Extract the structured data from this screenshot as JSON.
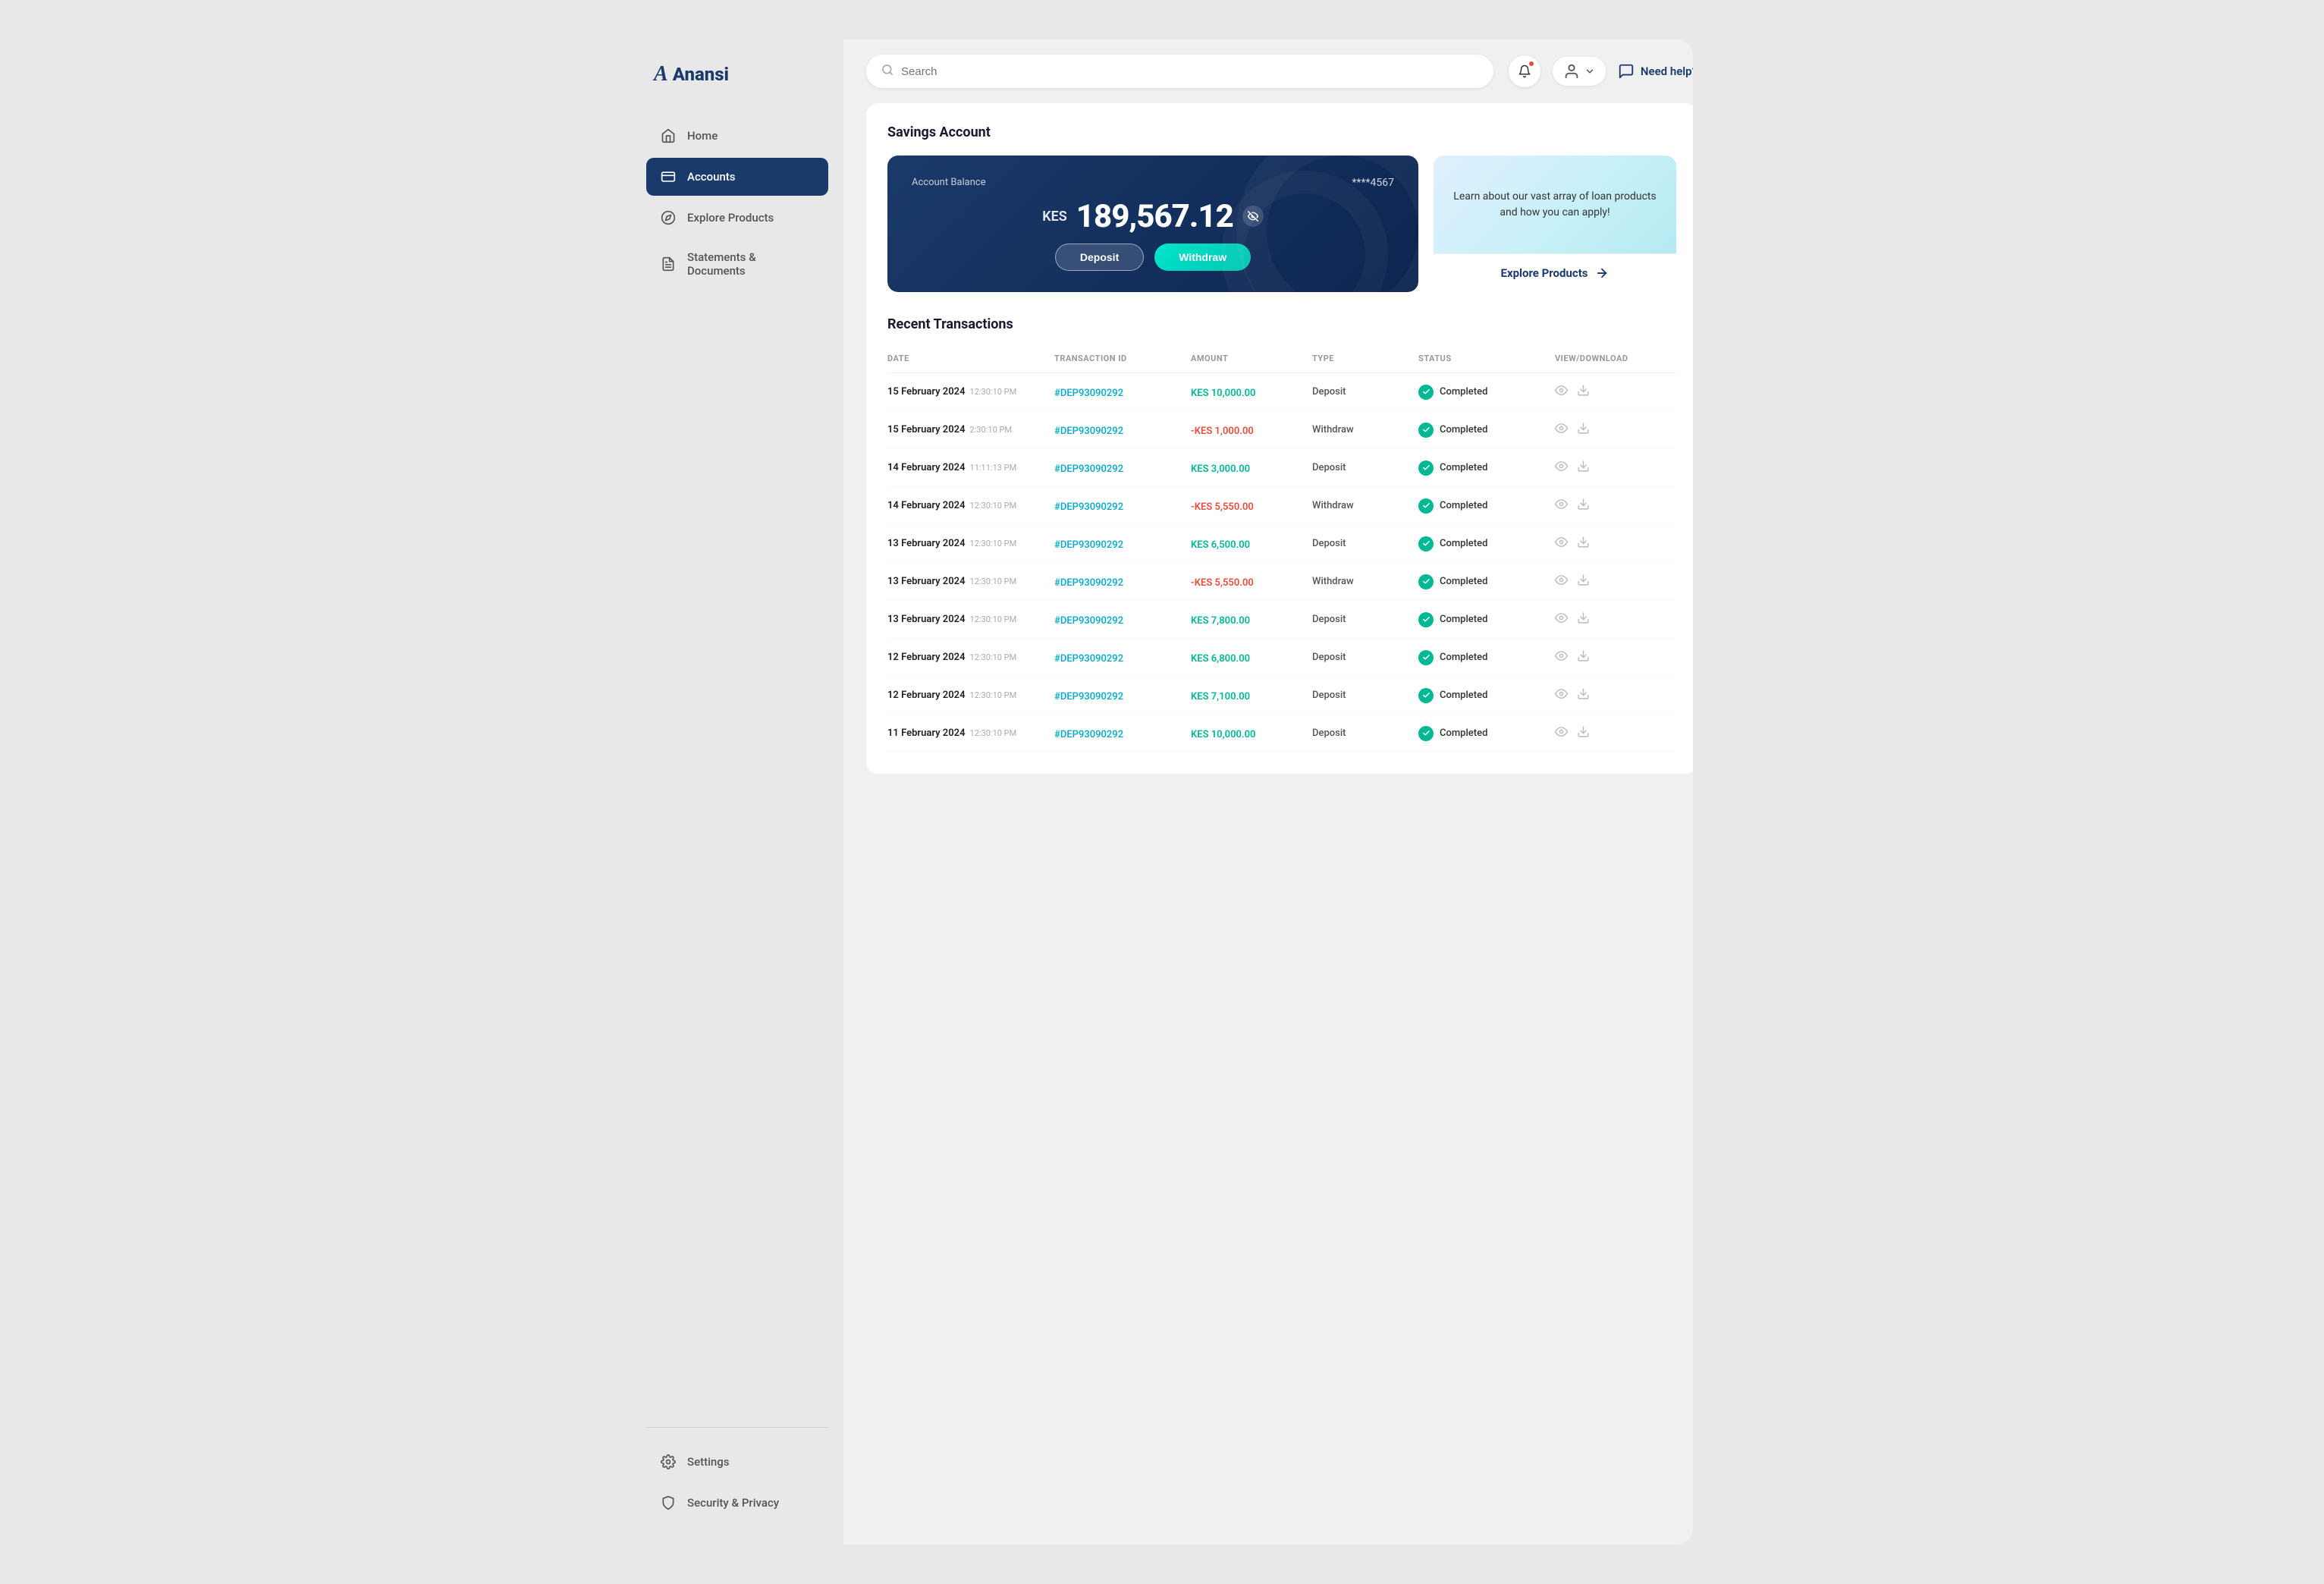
{
  "app": {
    "name": "Anansi",
    "logo_letter": "A"
  },
  "sidebar": {
    "nav_items": [
      {
        "id": "home",
        "label": "Home",
        "icon": "home"
      },
      {
        "id": "accounts",
        "label": "Accounts",
        "icon": "accounts",
        "active": true
      },
      {
        "id": "explore",
        "label": "Explore Products",
        "icon": "explore"
      },
      {
        "id": "statements",
        "label": "Statements & Documents",
        "icon": "statements"
      }
    ],
    "bottom_items": [
      {
        "id": "settings",
        "label": "Settings",
        "icon": "settings"
      },
      {
        "id": "security",
        "label": "Security & Privacy",
        "icon": "security"
      }
    ]
  },
  "header": {
    "search_placeholder": "Search",
    "need_help_label": "Need help?"
  },
  "page": {
    "section_title": "Savings Account",
    "balance_card": {
      "label": "Account Balance",
      "card_number": "****4567",
      "currency": "KES",
      "amount": "189,567.12",
      "deposit_btn": "Deposit",
      "withdraw_btn": "Withdraw"
    },
    "promo_card": {
      "text": "Learn about our vast array of loan products and how you can apply!",
      "cta_label": "Explore Products"
    },
    "transactions": {
      "title": "Recent Transactions",
      "columns": [
        "DATE",
        "Transaction ID",
        "Amount",
        "TYPE",
        "STATUS",
        "VIEW/DOWNLOAD"
      ],
      "rows": [
        {
          "date": "15 February 2024",
          "time": "12:30:10 PM",
          "txn_id": "#DEP93090292",
          "amount": "KES 10,000.00",
          "amount_type": "positive",
          "type": "Deposit",
          "status": "Completed"
        },
        {
          "date": "15 February 2024",
          "time": "2:30:10 PM",
          "txn_id": "#DEP93090292",
          "amount": "-KES 1,000.00",
          "amount_type": "negative",
          "type": "Withdraw",
          "status": "Completed"
        },
        {
          "date": "14 February 2024",
          "time": "11:11:13 PM",
          "txn_id": "#DEP93090292",
          "amount": "KES 3,000.00",
          "amount_type": "positive",
          "type": "Deposit",
          "status": "Completed"
        },
        {
          "date": "14 February 2024",
          "time": "12:30:10 PM",
          "txn_id": "#DEP93090292",
          "amount": "-KES 5,550.00",
          "amount_type": "negative",
          "type": "Withdraw",
          "status": "Completed"
        },
        {
          "date": "13 February 2024",
          "time": "12:30:10 PM",
          "txn_id": "#DEP93090292",
          "amount": "KES 6,500.00",
          "amount_type": "positive",
          "type": "Deposit",
          "status": "Completed"
        },
        {
          "date": "13 February 2024",
          "time": "12:30:10 PM",
          "txn_id": "#DEP93090292",
          "amount": "-KES 5,550.00",
          "amount_type": "negative",
          "type": "Withdraw",
          "status": "Completed"
        },
        {
          "date": "13 February 2024",
          "time": "12:30:10 PM",
          "txn_id": "#DEP93090292",
          "amount": "KES 7,800.00",
          "amount_type": "positive",
          "type": "Deposit",
          "status": "Completed"
        },
        {
          "date": "12 February 2024",
          "time": "12:30:10 PM",
          "txn_id": "#DEP93090292",
          "amount": "KES 6,800.00",
          "amount_type": "positive",
          "type": "Deposit",
          "status": "Completed"
        },
        {
          "date": "12 February 2024",
          "time": "12:30:10 PM",
          "txn_id": "#DEP93090292",
          "amount": "KES 7,100.00",
          "amount_type": "positive",
          "type": "Deposit",
          "status": "Completed"
        },
        {
          "date": "11 February 2024",
          "time": "12:30:10 PM",
          "txn_id": "#DEP93090292",
          "amount": "KES 10,000.00",
          "amount_type": "positive",
          "type": "Deposit",
          "status": "Completed"
        }
      ]
    }
  }
}
